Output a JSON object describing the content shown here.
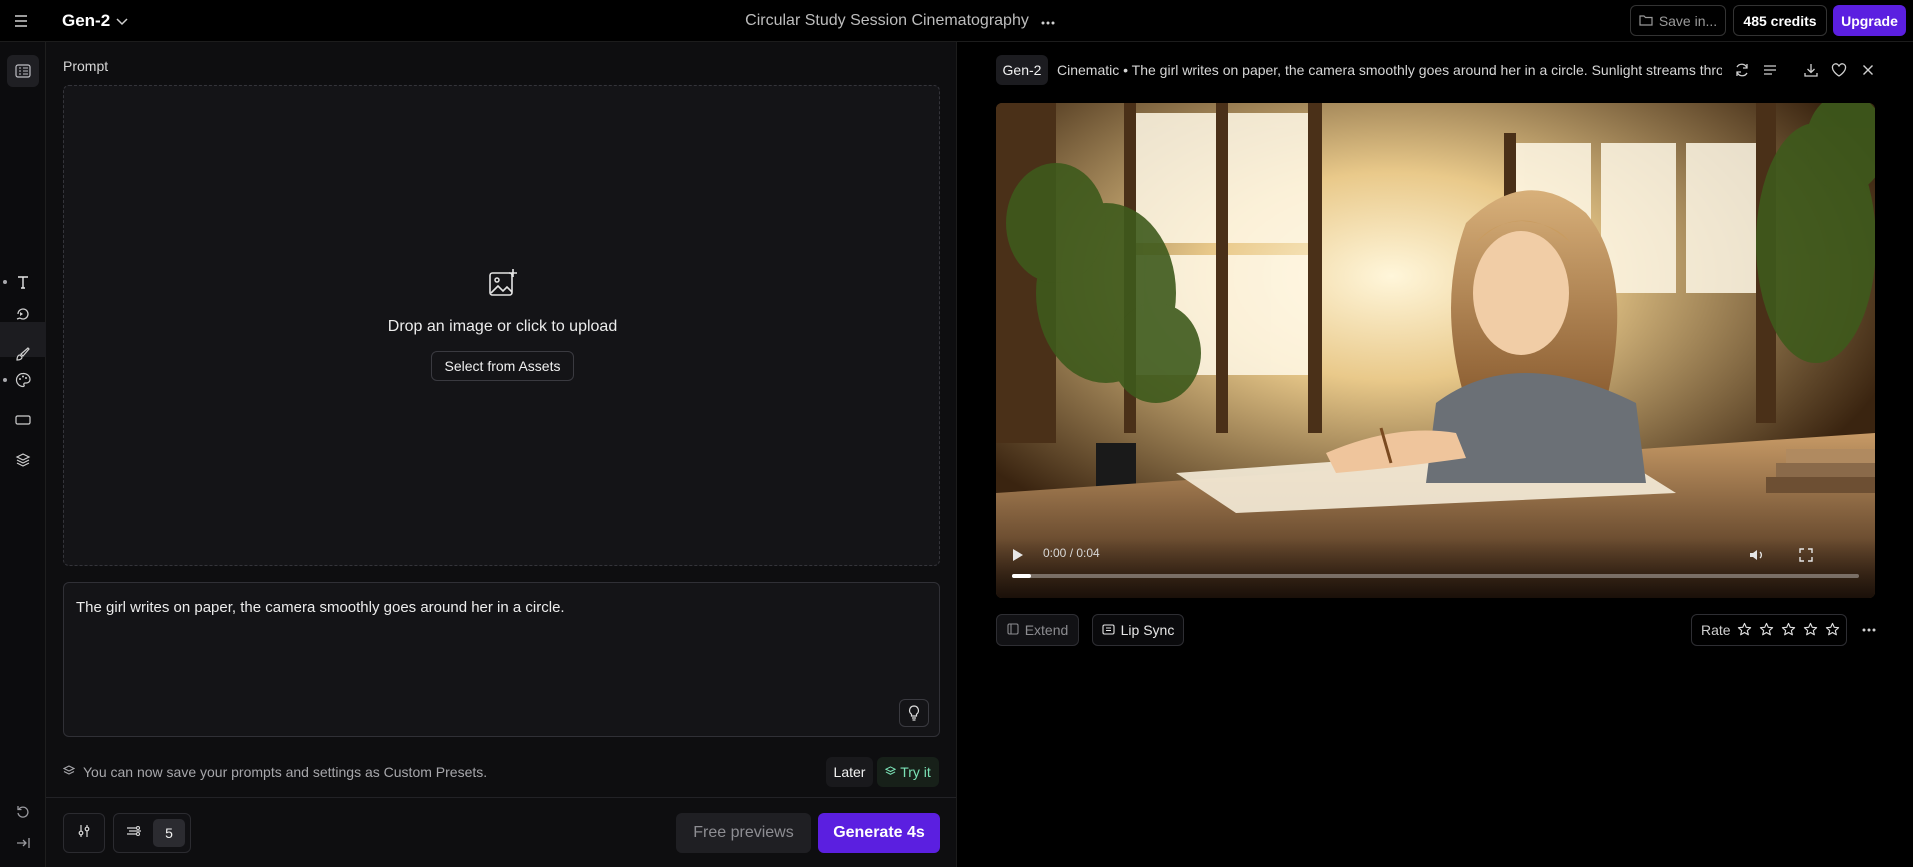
{
  "header": {
    "app_name": "Gen-2",
    "project_title": "Circular Study Session Cinematography",
    "save_label": "Save in...",
    "credits_label": "485 credits",
    "upgrade_label": "Upgrade"
  },
  "left_panel": {
    "section_label": "Prompt",
    "upload": {
      "text": "Drop an image or click to upload",
      "assets_button": "Select from Assets"
    },
    "prompt_text": "The girl writes on paper, the camera smoothly goes around her in a circle.",
    "notice": {
      "text": "You can now save your prompts and settings as Custom Presets.",
      "later_label": "Later",
      "try_label": "Try it"
    },
    "footer": {
      "count": "5",
      "free_previews_label": "Free previews",
      "generate_label": "Generate 4s"
    }
  },
  "result": {
    "model": "Gen-2",
    "title": "Cinematic • The girl writes on paper, the camera smoothly goes around her in a circle. Sunlight streams throu",
    "time": "0:00 / 0:04",
    "progress": 0.022,
    "extend_label": "Extend",
    "lip_sync_label": "Lip Sync",
    "rate_label": "Rate",
    "stars": 5
  },
  "colors": {
    "accent": "#5b1fe0",
    "success": "#7be2b6",
    "background": "#000000",
    "panel": "#0e0e10"
  },
  "icons": [
    "menu-icon",
    "chevron-down-icon",
    "more-horizontal-icon",
    "folder-icon",
    "sidebar-toggle-icon",
    "text-icon",
    "image-to-video-icon",
    "brush-icon",
    "palette-icon",
    "aspect-ratio-icon",
    "layers-icon",
    "undo-icon",
    "collapse-icon",
    "image-upload-icon",
    "lightbulb-icon",
    "preset-icon",
    "settings-sliders-icon",
    "motion-icon",
    "refresh-icon",
    "list-icon",
    "download-icon",
    "heart-icon",
    "close-icon",
    "play-icon",
    "volume-icon",
    "fullscreen-icon",
    "extend-icon",
    "lip-sync-icon",
    "star-icon",
    "more-icon"
  ]
}
